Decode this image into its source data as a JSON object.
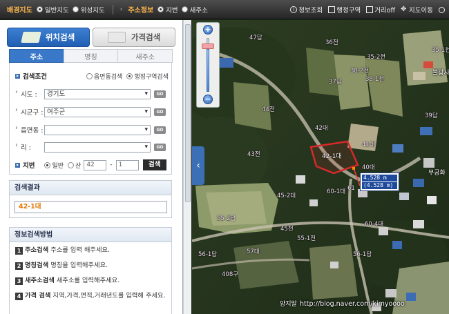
{
  "toolbar": {
    "bg_map_heading": "배경지도",
    "bg_options": [
      {
        "label": "일반지도",
        "selected": true
      },
      {
        "label": "위성지도",
        "selected": false
      }
    ],
    "info_heading": "주소정보",
    "info_options": [
      {
        "label": "지번",
        "selected": true
      },
      {
        "label": "새주소",
        "selected": false
      }
    ],
    "buttons": [
      {
        "label": "정보조회",
        "icon": "info-icon"
      },
      {
        "label": "행정구역",
        "icon": "document-icon"
      },
      {
        "label": "거리off",
        "icon": "ruler-icon"
      },
      {
        "label": "지도이동",
        "icon": "move-icon"
      },
      {
        "label": "",
        "icon": "zoom-icon"
      }
    ]
  },
  "panel": {
    "main_tabs": [
      {
        "label": "위치검색",
        "active": true
      },
      {
        "label": "가격검색",
        "active": false
      }
    ],
    "sub_tabs": [
      {
        "label": "주소",
        "active": true
      },
      {
        "label": "명칭",
        "active": false
      },
      {
        "label": "새주소",
        "active": false
      }
    ],
    "search": {
      "condition_label": "검색조건",
      "options": [
        {
          "label": "읍면동검색",
          "selected": false
        },
        {
          "label": "행정구역검색",
          "selected": true
        }
      ],
      "fields": [
        {
          "label": "시도 :",
          "value": "경기도"
        },
        {
          "label": "시군구 :",
          "value": "여주군"
        },
        {
          "label": "읍면동 :",
          "value": ""
        },
        {
          "label": "리 :",
          "value": ""
        }
      ],
      "go_label": "GO",
      "jibun": {
        "label": "지번",
        "options": [
          {
            "label": "일반",
            "selected": true
          },
          {
            "label": "산",
            "selected": false
          }
        ],
        "main_no": "42",
        "sub_no": "1",
        "search_button": "검색"
      }
    },
    "result": {
      "heading": "검색결과",
      "value": "42-1대"
    },
    "method": {
      "heading": "정보검색방법",
      "items": [
        {
          "num": "1",
          "title": "주소검색",
          "desc": "주소를 입력 해주세요."
        },
        {
          "num": "2",
          "title": "명칭검색",
          "desc": "명칭을 입력해주세요."
        },
        {
          "num": "3",
          "title": "새주소검색",
          "desc": "새주소를 입력해주세요."
        },
        {
          "num": "4",
          "title": "가격 검색",
          "desc": "지역,가격,면적,거래년도를 입력해 주세요."
        }
      ]
    }
  },
  "map": {
    "zoom_level_fraction": 0.15,
    "lots": [
      "47답",
      "36전",
      "35-1천",
      "35-2전",
      "37답",
      "38-2전",
      "38-1천",
      "44전",
      "42대",
      "39답",
      "43전",
      "42-1대",
      "41대",
      "40대",
      "60-1대",
      "61",
      "45-2대",
      "55-2답",
      "60-4대",
      "56-1답",
      "57대",
      "55-1전",
      "56-1답",
      "408구",
      "45천"
    ],
    "places": [
      "불광사",
      "무궁화",
      "양지말"
    ],
    "measure": {
      "line1": "4.528 m",
      "line2": "(4.528 m)"
    },
    "watermark": "http://blog.naver.com/kimyoooo",
    "selected_color": "#d42a2a"
  }
}
